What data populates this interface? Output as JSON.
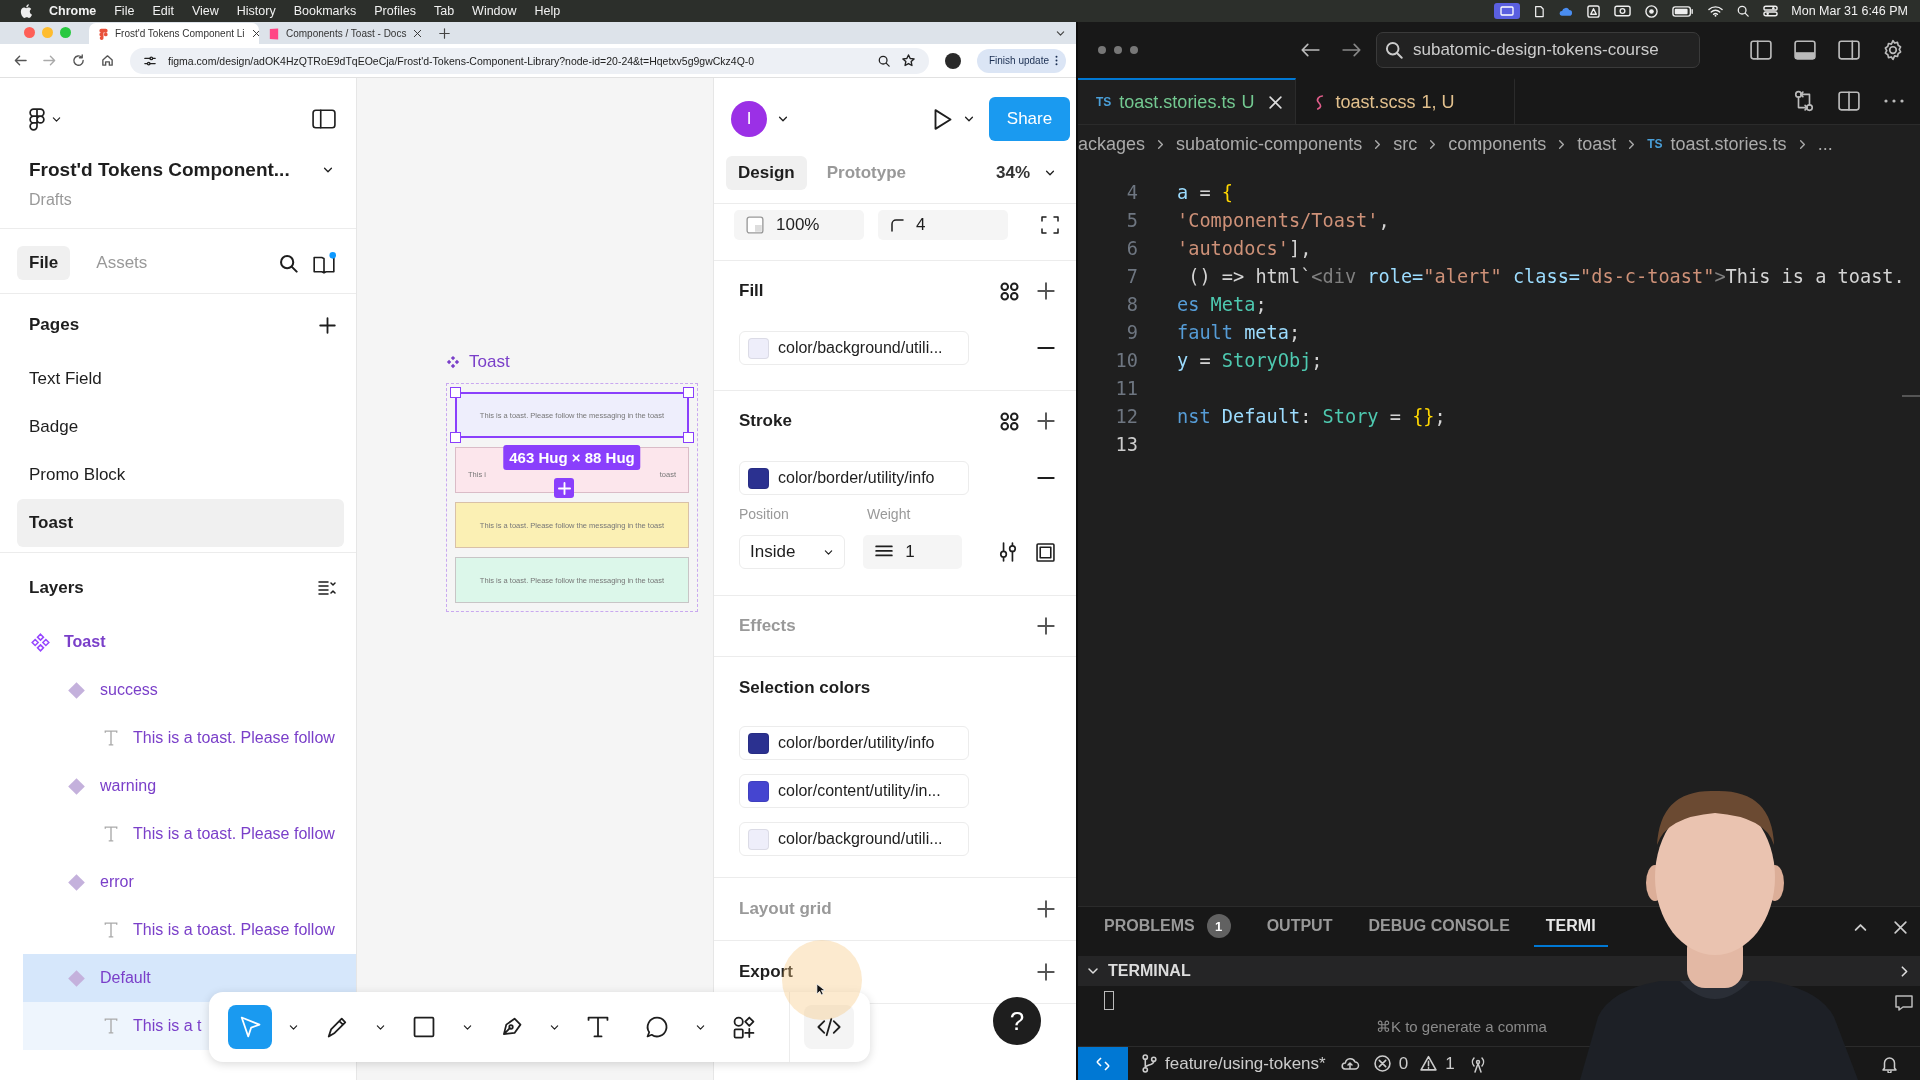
{
  "menubar": {
    "app": "Chrome",
    "menus": [
      "File",
      "Edit",
      "View",
      "History",
      "Bookmarks",
      "Profiles",
      "Tab",
      "Window",
      "Help"
    ],
    "clock": "Mon Mar 31  6:46 PM"
  },
  "browser": {
    "tabs": [
      {
        "title": "Frost'd Tokens Component Li",
        "kind": "figma",
        "selected": true
      },
      {
        "title": "Components / Toast - Docs",
        "kind": "storybook",
        "selected": false
      }
    ],
    "url": "figma.com/design/adOK4HzQTRoE9dTqEOeCja/Frost'd-Tokens-Component-Library?node-id=20-24&t=Hqetxv5g9gwCkz4Q-0",
    "update_button": "Finish update"
  },
  "figma": {
    "file_title": "Frost'd Tokens Component...",
    "location": "Drafts",
    "left_tabs": [
      {
        "label": "File",
        "selected": true
      },
      {
        "label": "Assets",
        "selected": false
      }
    ],
    "pages_title": "Pages",
    "pages": [
      {
        "label": "Text Field",
        "selected": false
      },
      {
        "label": "Badge",
        "selected": false
      },
      {
        "label": "Promo Block",
        "selected": false
      },
      {
        "label": "Toast",
        "selected": true
      }
    ],
    "layers_title": "Layers",
    "layers": [
      {
        "label": "Toast",
        "kind": "component_set",
        "selected": false,
        "children": [
          {
            "label": "success",
            "kind": "variant",
            "selected": false,
            "children": [
              {
                "label": "This is a toast. Please follow",
                "kind": "text",
                "selected": false
              }
            ]
          },
          {
            "label": "warning",
            "kind": "variant",
            "selected": false,
            "children": [
              {
                "label": "This is a toast. Please follow",
                "kind": "text",
                "selected": false
              }
            ]
          },
          {
            "label": "error",
            "kind": "variant",
            "selected": false,
            "children": [
              {
                "label": "This is a toast. Please follow",
                "kind": "text",
                "selected": false
              }
            ]
          },
          {
            "label": "Default",
            "kind": "variant",
            "selected": true,
            "children": [
              {
                "label": "This is a t",
                "kind": "text",
                "selected": false
              }
            ]
          }
        ]
      }
    ],
    "canvas": {
      "frame_label": "Toast",
      "size_badge": "463 Hug × 88 Hug",
      "toasts": [
        {
          "text": "This is a toast. Please follow the messaging in the toast",
          "color": "#eeeefc",
          "selected": true
        },
        {
          "text_parts": [
            "This i",
            "toast"
          ],
          "color": "#fce6ec",
          "selected": false
        },
        {
          "text": "This is a toast. Please follow the messaging in the toast",
          "color": "#fbf0b4",
          "selected": false
        },
        {
          "text": "This is a toast. Please follow the messaging in the toast",
          "color": "#dcf7ea",
          "selected": false
        }
      ]
    },
    "toolbar": [
      {
        "kind": "move",
        "selected": true,
        "dropdown": true
      },
      {
        "kind": "pencil",
        "selected": false,
        "dropdown": true
      },
      {
        "kind": "rectangle",
        "selected": false,
        "dropdown": true
      },
      {
        "kind": "pen",
        "selected": false,
        "dropdown": true
      },
      {
        "kind": "text",
        "selected": false,
        "dropdown": false
      },
      {
        "kind": "comment",
        "selected": false,
        "dropdown": true
      },
      {
        "kind": "actions",
        "selected": false,
        "dropdown": false
      },
      {
        "kind": "code",
        "selected": false,
        "dropdown": false
      }
    ],
    "right": {
      "avatar": "I",
      "share": "Share",
      "tabs": [
        {
          "label": "Design",
          "selected": true
        },
        {
          "label": "Prototype",
          "selected": false
        }
      ],
      "zoom": "34%",
      "opacity": "100%",
      "radius": "4",
      "sections": [
        {
          "kind": "fill",
          "title": "Fill",
          "dimmed": false,
          "swatches": [
            {
              "name": "color/background/utili...",
              "color": "#eeeefa"
            }
          ]
        },
        {
          "kind": "stroke",
          "title": "Stroke",
          "dimmed": false,
          "swatches": [
            {
              "name": "color/border/utility/info",
              "color": "#2b3190"
            }
          ],
          "position_label": "Position",
          "position": "Inside",
          "weight_label": "Weight",
          "weight": "1"
        },
        {
          "kind": "effects",
          "title": "Effects",
          "dimmed": true
        },
        {
          "kind": "selection",
          "title": "Selection colors",
          "dimmed": false,
          "swatches": [
            {
              "name": "color/border/utility/info",
              "color": "#2b3190"
            },
            {
              "name": "color/content/utility/in...",
              "color": "#4545d0"
            },
            {
              "name": "color/background/utili...",
              "color": "#eeeefa"
            }
          ]
        },
        {
          "kind": "layout_grid",
          "title": "Layout grid",
          "dimmed": true
        },
        {
          "kind": "export",
          "title": "Export",
          "dimmed": false
        }
      ],
      "help": "?"
    }
  },
  "editor": {
    "search": "subatomic-design-tokens-course",
    "tabs": [
      {
        "icon_text": "TS",
        "name": "toast.stories.ts",
        "status": "U",
        "kind": "ts",
        "selected": true
      },
      {
        "name": "toast.scss",
        "status": "1, U",
        "kind": "scss",
        "selected": false
      }
    ],
    "breadcrumbs": [
      {
        "text": "ackages"
      },
      {
        "text": "subatomic-components"
      },
      {
        "text": "src"
      },
      {
        "text": "components"
      },
      {
        "text": "toast"
      },
      {
        "icon_text": "TS",
        "text": "toast.stories.ts"
      },
      {
        "text": "..."
      }
    ],
    "lines": [
      {
        "number": "4",
        "current": false,
        "tokens": [
          {
            "text": "a",
            "kind": "var"
          },
          {
            "text": " = ",
            "kind": "punct"
          },
          {
            "text": "{",
            "kind": "bracket"
          }
        ]
      },
      {
        "number": "5",
        "current": false,
        "tokens": [
          {
            "text": "'Components/Toast'",
            "kind": "string"
          },
          {
            "text": ",",
            "kind": "punct"
          }
        ]
      },
      {
        "number": "6",
        "current": false,
        "tokens": [
          {
            "text": "'autodocs'",
            "kind": "string"
          },
          {
            "text": "],",
            "kind": "punct"
          }
        ]
      },
      {
        "number": "7",
        "current": false,
        "tokens": [
          {
            "text": " () => ",
            "kind": "punct"
          },
          {
            "text": "html",
            "kind": "plain"
          },
          {
            "text": "`",
            "kind": "punct"
          },
          {
            "text": "<div",
            "kind": "tag"
          },
          {
            "text": " role=",
            "kind": "attr"
          },
          {
            "text": "\"alert\"",
            "kind": "string"
          },
          {
            "text": " class=",
            "kind": "attr"
          },
          {
            "text": "\"ds-c-toast\"",
            "kind": "string"
          },
          {
            "text": ">",
            "kind": "tag"
          },
          {
            "text": "This is a toast.",
            "kind": "plain"
          }
        ]
      },
      {
        "number": "8",
        "current": false,
        "tokens": [
          {
            "text": "es",
            "kind": "keyword"
          },
          {
            "text": " Meta",
            "kind": "type"
          },
          {
            "text": ";",
            "kind": "punct"
          }
        ]
      },
      {
        "number": "9",
        "current": false,
        "tokens": [
          {
            "text": "fault",
            "kind": "keyword"
          },
          {
            "text": " meta",
            "kind": "var"
          },
          {
            "text": ";",
            "kind": "punct"
          }
        ]
      },
      {
        "number": "10",
        "current": false,
        "tokens": [
          {
            "text": "y",
            "kind": "var"
          },
          {
            "text": " = ",
            "kind": "punct"
          },
          {
            "text": "StoryObj",
            "kind": "type"
          },
          {
            "text": ";",
            "kind": "punct"
          }
        ]
      },
      {
        "number": "11",
        "current": false
      },
      {
        "number": "12",
        "current": false,
        "tokens": [
          {
            "text": "nst",
            "kind": "keyword"
          },
          {
            "text": " Default",
            "kind": "var"
          },
          {
            "text": ": ",
            "kind": "punct"
          },
          {
            "text": "Story",
            "kind": "type"
          },
          {
            "text": " = ",
            "kind": "punct"
          },
          {
            "text": "{}",
            "kind": "bracket"
          },
          {
            "text": ";",
            "kind": "punct"
          }
        ]
      },
      {
        "number": "13",
        "current": true
      }
    ],
    "panel_tabs": [
      {
        "label": "PROBLEMS",
        "badge": "1",
        "selected": false
      },
      {
        "label": "OUTPUT",
        "selected": false
      },
      {
        "label": "DEBUG CONSOLE",
        "selected": false
      },
      {
        "label": "TERMI",
        "selected": true
      }
    ],
    "terminal_title": "TERMINAL",
    "terminal_hint": "⌘K to generate a comma",
    "status": {
      "branch": "feature/using-tokens*",
      "errors": "0",
      "warnings": "1"
    }
  }
}
